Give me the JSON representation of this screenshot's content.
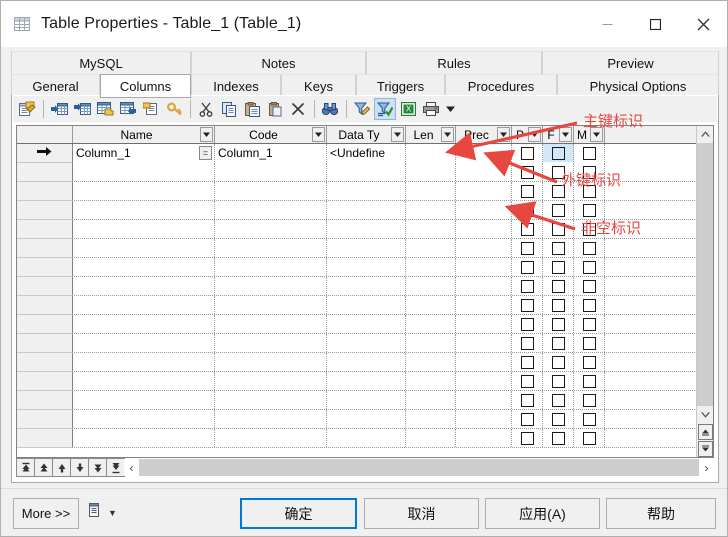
{
  "window": {
    "title": "Table Properties - Table_1 (Table_1)",
    "icon": "table-icon",
    "minimize_label": "—",
    "maximize_label": "□",
    "close_label": "✕"
  },
  "tabs": {
    "row1": [
      {
        "label": "MySQL",
        "selected": false,
        "width": 180
      },
      {
        "label": "Notes",
        "selected": false,
        "width": 175
      },
      {
        "label": "Rules",
        "selected": false,
        "width": 176
      },
      {
        "label": "Preview",
        "selected": false,
        "width": 177
      }
    ],
    "row2": [
      {
        "label": "General",
        "selected": false,
        "width": 89
      },
      {
        "label": "Columns",
        "selected": true,
        "width": 91
      },
      {
        "label": "Indexes",
        "selected": false,
        "width": 90
      },
      {
        "label": "Keys",
        "selected": false,
        "width": 75
      },
      {
        "label": "Triggers",
        "selected": false,
        "width": 89
      },
      {
        "label": "Procedures",
        "selected": false,
        "width": 112
      },
      {
        "label": "Physical Options",
        "selected": false,
        "width": 162
      }
    ]
  },
  "toolbar": {
    "items": [
      {
        "name": "properties-icon",
        "kind": "icon",
        "glyph": "props"
      },
      {
        "name": "separator",
        "kind": "sep"
      },
      {
        "name": "insert-row-icon",
        "kind": "icon",
        "glyph": "insert"
      },
      {
        "name": "insert-row-after-icon",
        "kind": "icon",
        "glyph": "insert2"
      },
      {
        "name": "add-row-icon",
        "kind": "icon",
        "glyph": "add"
      },
      {
        "name": "delete-row-icon",
        "kind": "icon",
        "glyph": "remove"
      },
      {
        "name": "properties-list-icon",
        "kind": "icon",
        "glyph": "list"
      },
      {
        "name": "key-icon",
        "kind": "icon",
        "glyph": "key"
      },
      {
        "name": "separator",
        "kind": "sep"
      },
      {
        "name": "cut-icon",
        "kind": "icon",
        "glyph": "cut"
      },
      {
        "name": "copy-icon",
        "kind": "icon",
        "glyph": "copy"
      },
      {
        "name": "paste-icon",
        "kind": "icon",
        "glyph": "paste"
      },
      {
        "name": "paste-special-icon",
        "kind": "icon",
        "glyph": "paste2"
      },
      {
        "name": "delete-icon",
        "kind": "icon",
        "glyph": "x"
      },
      {
        "name": "separator",
        "kind": "sep"
      },
      {
        "name": "find-icon",
        "kind": "icon",
        "glyph": "binoculars"
      },
      {
        "name": "separator",
        "kind": "sep"
      },
      {
        "name": "filter-icon",
        "kind": "icon",
        "glyph": "filter"
      },
      {
        "name": "apply-filter-icon",
        "kind": "icon",
        "glyph": "filter-check",
        "active": true
      },
      {
        "name": "export-excel-icon",
        "kind": "icon",
        "glyph": "excel"
      },
      {
        "name": "print-icon",
        "kind": "icon",
        "glyph": "printer"
      },
      {
        "name": "print-dropdown-caret-icon",
        "kind": "caret"
      }
    ]
  },
  "grid": {
    "columns": [
      {
        "key": "rowhead",
        "label": "",
        "width": 56,
        "dropdown": false,
        "type": "rowhead"
      },
      {
        "key": "name",
        "label": "Name",
        "width": 142,
        "dropdown": true,
        "type": "text"
      },
      {
        "key": "code",
        "label": "Code",
        "width": 112,
        "dropdown": true,
        "type": "text"
      },
      {
        "key": "datatype",
        "label": "Data Ty",
        "width": 79,
        "dropdown": true,
        "type": "text"
      },
      {
        "key": "len",
        "label": "Len",
        "width": 50,
        "dropdown": true,
        "type": "text"
      },
      {
        "key": "prec",
        "label": "Prec",
        "width": 56,
        "dropdown": true,
        "type": "text"
      },
      {
        "key": "p",
        "label": "P",
        "width": 31,
        "dropdown": true,
        "type": "check"
      },
      {
        "key": "f",
        "label": "F",
        "width": 31,
        "dropdown": true,
        "type": "check"
      },
      {
        "key": "m",
        "label": "M",
        "width": 31,
        "dropdown": true,
        "type": "check"
      },
      {
        "key": "filler",
        "label": "",
        "width": 108,
        "dropdown": false,
        "type": "filler"
      }
    ],
    "row_indicator": "➡",
    "rows": [
      {
        "indicator": true,
        "name": "Column_1",
        "name_editbtn": true,
        "code": "Column_1",
        "datatype": "<Undefine",
        "len": "",
        "prec": "",
        "p": false,
        "f": false,
        "m": false,
        "f_focused": true
      },
      {
        "indicator": false,
        "name": "",
        "code": "",
        "datatype": "",
        "len": "",
        "prec": "",
        "p": false,
        "f": false,
        "m": false
      },
      {
        "indicator": false,
        "name": "",
        "code": "",
        "datatype": "",
        "len": "",
        "prec": "",
        "p": false,
        "f": false,
        "m": false
      },
      {
        "indicator": false,
        "name": "",
        "code": "",
        "datatype": "",
        "len": "",
        "prec": "",
        "p": false,
        "f": false,
        "m": false
      },
      {
        "indicator": false,
        "name": "",
        "code": "",
        "datatype": "",
        "len": "",
        "prec": "",
        "p": false,
        "f": false,
        "m": false
      },
      {
        "indicator": false,
        "name": "",
        "code": "",
        "datatype": "",
        "len": "",
        "prec": "",
        "p": false,
        "f": false,
        "m": false
      },
      {
        "indicator": false,
        "name": "",
        "code": "",
        "datatype": "",
        "len": "",
        "prec": "",
        "p": false,
        "f": false,
        "m": false
      },
      {
        "indicator": false,
        "name": "",
        "code": "",
        "datatype": "",
        "len": "",
        "prec": "",
        "p": false,
        "f": false,
        "m": false
      },
      {
        "indicator": false,
        "name": "",
        "code": "",
        "datatype": "",
        "len": "",
        "prec": "",
        "p": false,
        "f": false,
        "m": false
      },
      {
        "indicator": false,
        "name": "",
        "code": "",
        "datatype": "",
        "len": "",
        "prec": "",
        "p": false,
        "f": false,
        "m": false
      },
      {
        "indicator": false,
        "name": "",
        "code": "",
        "datatype": "",
        "len": "",
        "prec": "",
        "p": false,
        "f": false,
        "m": false
      },
      {
        "indicator": false,
        "name": "",
        "code": "",
        "datatype": "",
        "len": "",
        "prec": "",
        "p": false,
        "f": false,
        "m": false
      },
      {
        "indicator": false,
        "name": "",
        "code": "",
        "datatype": "",
        "len": "",
        "prec": "",
        "p": false,
        "f": false,
        "m": false
      },
      {
        "indicator": false,
        "name": "",
        "code": "",
        "datatype": "",
        "len": "",
        "prec": "",
        "p": false,
        "f": false,
        "m": false
      },
      {
        "indicator": false,
        "name": "",
        "code": "",
        "datatype": "",
        "len": "",
        "prec": "",
        "p": false,
        "f": false,
        "m": false
      },
      {
        "indicator": false,
        "name": "",
        "code": "",
        "datatype": "",
        "len": "",
        "prec": "",
        "p": false,
        "f": false,
        "m": false
      }
    ]
  },
  "grid_nav": {
    "buttons": [
      {
        "name": "first-record-button",
        "glyph": "first"
      },
      {
        "name": "prev-page-button",
        "glyph": "prevpage"
      },
      {
        "name": "prev-record-button",
        "glyph": "prev"
      },
      {
        "name": "next-record-button",
        "glyph": "next"
      },
      {
        "name": "next-page-button",
        "glyph": "nextpage"
      },
      {
        "name": "last-record-button",
        "glyph": "last"
      }
    ],
    "scroll_left": "‹",
    "scroll_right": "›"
  },
  "scrollbar": {
    "up": "˄",
    "down": "˅",
    "spin_up": "▲",
    "spin_down": "▼"
  },
  "footer": {
    "more_label": "More >>",
    "print_icon": "print-list-icon",
    "print_caret": "▼",
    "ok_label": "确定",
    "cancel_label": "取消",
    "apply_label": "应用(A)",
    "help_label": "帮助"
  },
  "annotations": [
    {
      "name": "primary-key-annotation",
      "text": "主键标识"
    },
    {
      "name": "foreign-key-annotation",
      "text": "外键标识"
    },
    {
      "name": "not-null-annotation",
      "text": "非空标识"
    }
  ],
  "colors": {
    "annotation": "#e8473f",
    "default_button_border": "#0078d7",
    "focused_cell": "#d2e7f7",
    "dialog_bg": "#f0f0f0"
  }
}
